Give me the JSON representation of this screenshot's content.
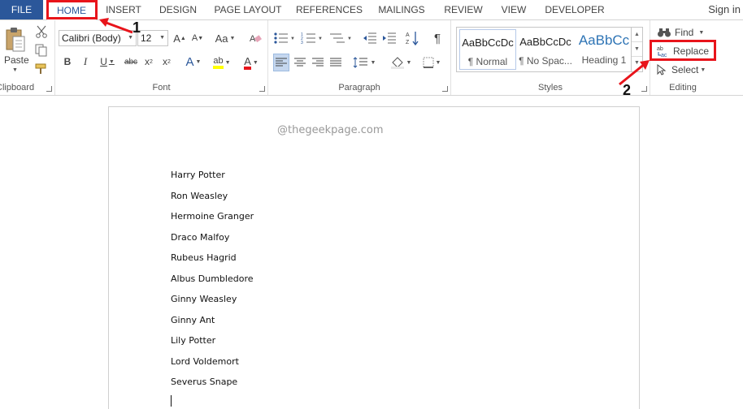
{
  "tabs": [
    "FILE",
    "HOME",
    "INSERT",
    "DESIGN",
    "PAGE LAYOUT",
    "REFERENCES",
    "MAILINGS",
    "REVIEW",
    "VIEW",
    "DEVELOPER"
  ],
  "active_tab": "HOME",
  "signin": "Sign in",
  "clipboard": {
    "paste_label": "Paste",
    "group_label": "Clipboard"
  },
  "font": {
    "font_name": "Calibri (Body)",
    "font_size": "12",
    "group_label": "Font"
  },
  "paragraph": {
    "group_label": "Paragraph"
  },
  "styles": {
    "items": [
      {
        "sample": "AaBbCcDc",
        "name": "¶ Normal"
      },
      {
        "sample": "AaBbCcDc",
        "name": "¶ No Spac..."
      },
      {
        "sample": "AaBbCc",
        "name": "Heading 1"
      }
    ],
    "group_label": "Styles"
  },
  "editing": {
    "find": "Find",
    "replace": "Replace",
    "select": "Select",
    "group_label": "Editing"
  },
  "annotations": {
    "step1": "1",
    "step2": "2",
    "highlight_color": "#e8141b"
  },
  "document": {
    "watermark": "@thegeekpage.com",
    "lines": [
      "Harry Potter",
      "Ron Weasley",
      "Hermoine Granger",
      "Draco Malfoy",
      "Rubeus Hagrid",
      "Albus Dumbledore",
      "Ginny Weasley",
      "Ginny Ant",
      "Lily Potter",
      "Lord Voldemort",
      "Severus Snape"
    ]
  },
  "colors": {
    "file_tab": "#2b579a",
    "accent": "#2b579a",
    "heading_blue": "#2e74b5"
  }
}
